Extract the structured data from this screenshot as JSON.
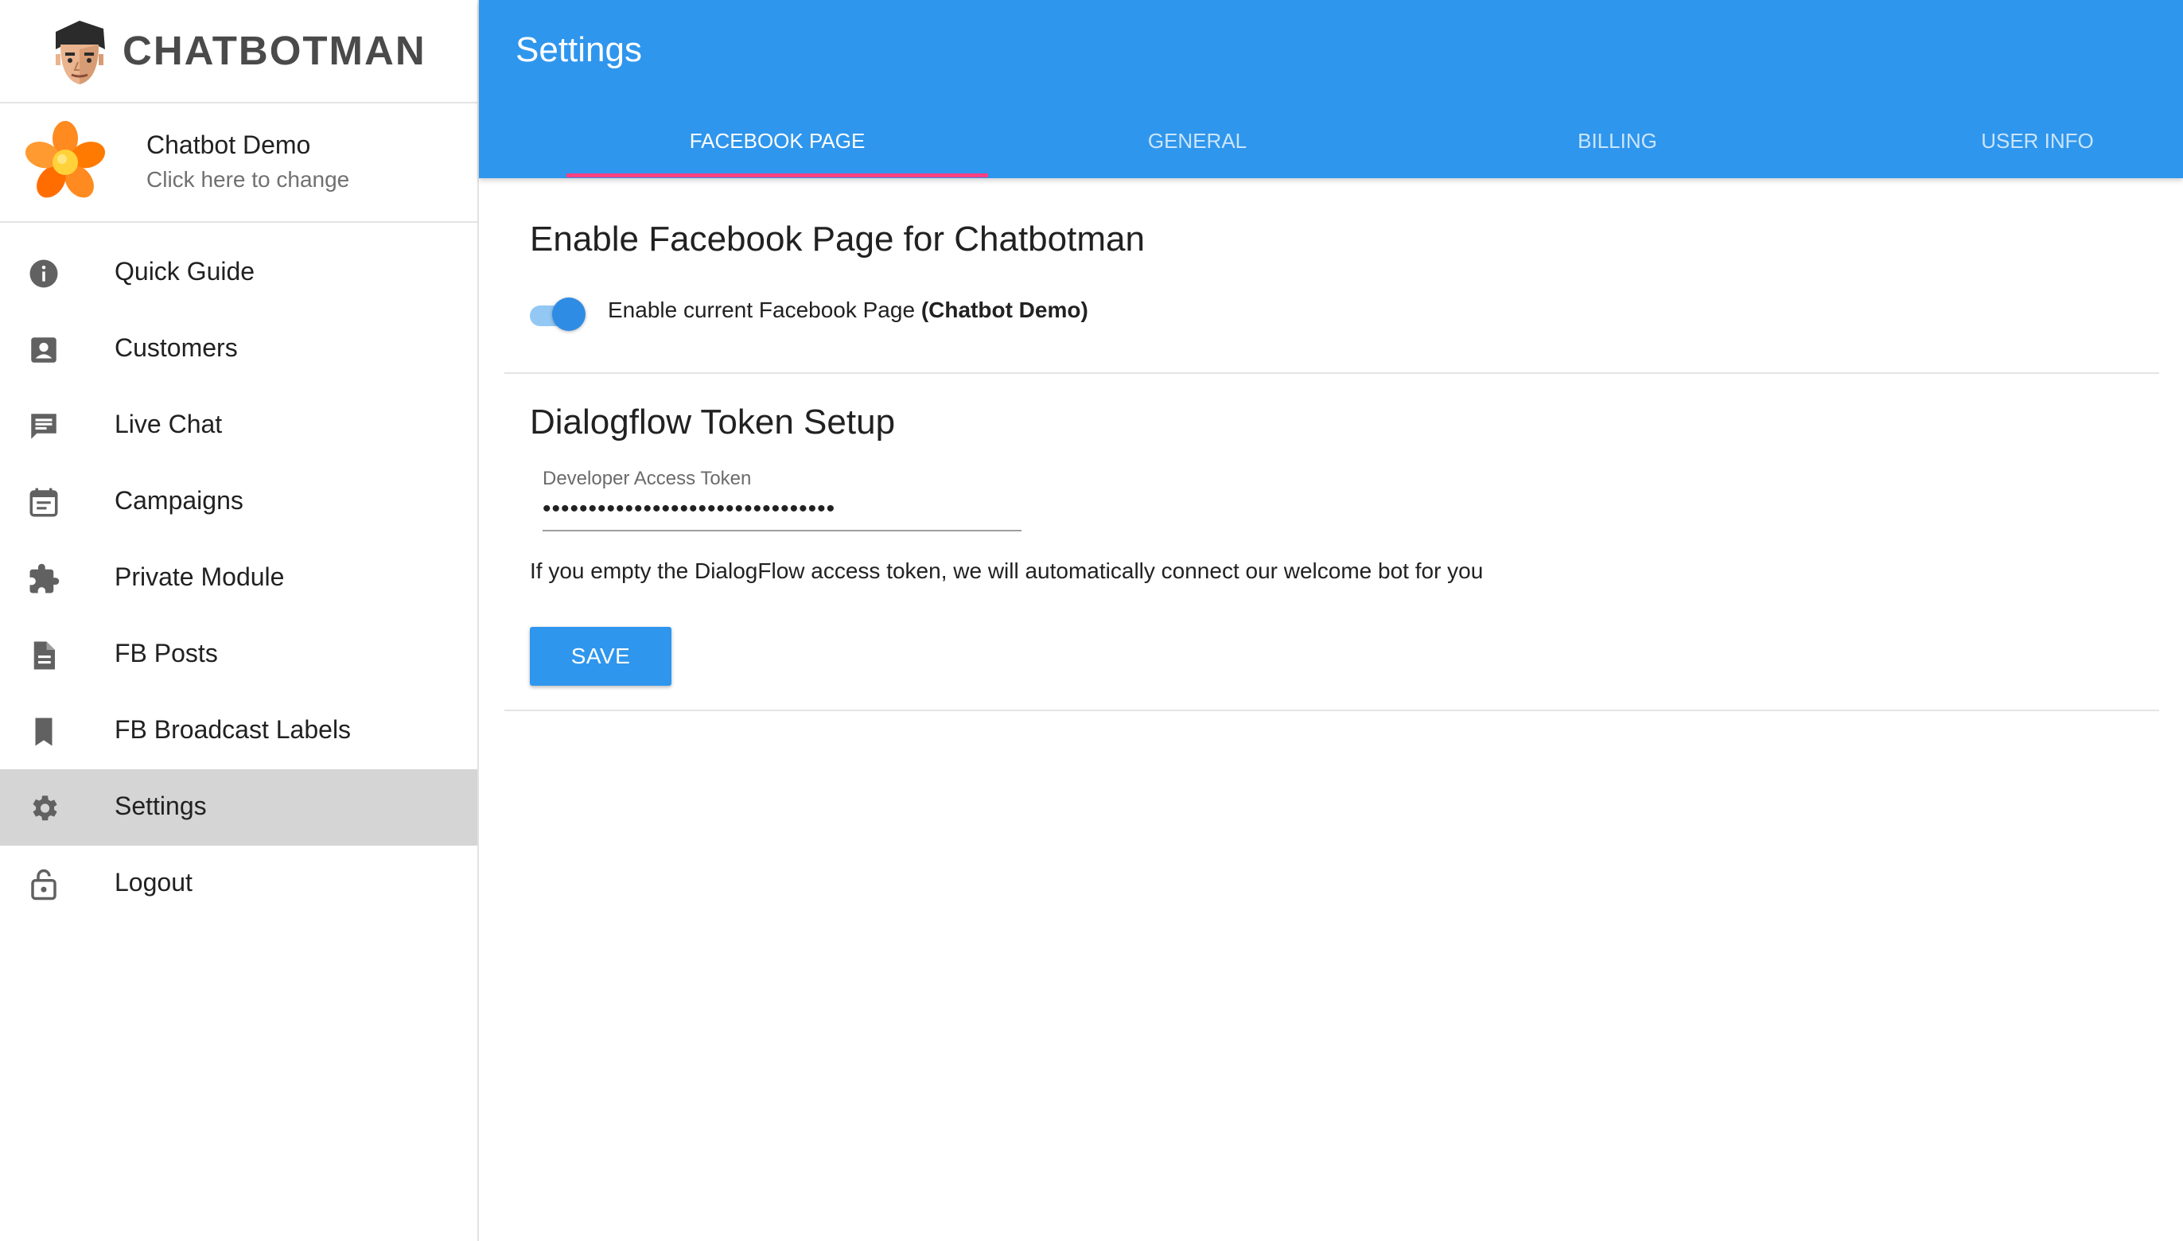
{
  "brand": {
    "name": "CHATBOTMAN",
    "logo_icon": "man-face-icon"
  },
  "page_switch": {
    "name": "Chatbot Demo",
    "subtitle": "Click here to change",
    "avatar_icon": "orange-flower-icon"
  },
  "sidebar": {
    "items": [
      {
        "label": "Quick Guide",
        "icon": "info-icon"
      },
      {
        "label": "Customers",
        "icon": "contact-icon"
      },
      {
        "label": "Live Chat",
        "icon": "chat-icon"
      },
      {
        "label": "Campaigns",
        "icon": "calendar-icon"
      },
      {
        "label": "Private Module",
        "icon": "puzzle-icon"
      },
      {
        "label": "FB Posts",
        "icon": "document-icon"
      },
      {
        "label": "FB Broadcast Labels",
        "icon": "bookmark-icon"
      },
      {
        "label": "Settings",
        "icon": "gear-icon",
        "active": true
      },
      {
        "label": "Logout",
        "icon": "lock-open-icon"
      }
    ]
  },
  "header": {
    "title": "Settings",
    "tabs": [
      {
        "label": "FACEBOOK PAGE",
        "active": true
      },
      {
        "label": "GENERAL"
      },
      {
        "label": "BILLING"
      },
      {
        "label": "USER INFO"
      }
    ]
  },
  "facebook_section": {
    "title": "Enable Facebook Page for Chatbotman",
    "toggle_label": "Enable current Facebook Page",
    "toggle_page": "(Chatbot Demo)",
    "toggle_on": true
  },
  "dialogflow_section": {
    "title": "Dialogflow Token Setup",
    "field_label": "Developer Access Token",
    "field_value": "••••••••••••••••••••••••••••••••",
    "hint": "If you empty the DialogFlow access token, we will automatically connect our welcome bot for you",
    "save_label": "SAVE"
  },
  "colors": {
    "primary": "#2f96ed",
    "tab_indicator": "#ff4081",
    "active_nav_bg": "#d5d5d5",
    "icon_gray": "#616161"
  }
}
